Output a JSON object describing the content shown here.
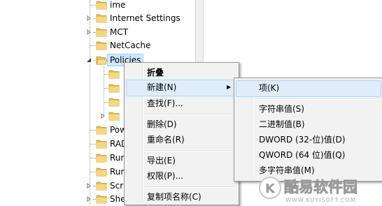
{
  "tree": {
    "items": [
      {
        "label": "ime",
        "expander": "none"
      },
      {
        "label": "Internet Settings",
        "expander": "collapsed"
      },
      {
        "label": "MCT",
        "expander": "collapsed"
      },
      {
        "label": "NetCache",
        "expander": "none"
      },
      {
        "label": "Policies",
        "expander": "expanded",
        "selected": true
      },
      {
        "label": "",
        "expander": "none"
      },
      {
        "label": "",
        "expander": "none"
      },
      {
        "label": "",
        "expander": "none"
      },
      {
        "label": "",
        "expander": "collapsed"
      },
      {
        "label": "Pow",
        "expander": "none"
      },
      {
        "label": "RAD",
        "expander": "none"
      },
      {
        "label": "Run",
        "expander": "none"
      },
      {
        "label": "Run",
        "expander": "none"
      },
      {
        "label": "Scr",
        "expander": "collapsed"
      },
      {
        "label": "She",
        "expander": "collapsed"
      }
    ]
  },
  "context_menu": {
    "items": [
      {
        "label": "折叠",
        "bold": true
      },
      {
        "label": "新建(N)",
        "submenu": true,
        "highlighted": true
      },
      {
        "label": "查找(F)..."
      },
      {
        "separator": true
      },
      {
        "label": "删除(D)"
      },
      {
        "label": "重命名(R)"
      },
      {
        "separator": true
      },
      {
        "label": "导出(E)"
      },
      {
        "label": "权限(P)..."
      },
      {
        "separator": true
      },
      {
        "label": "复制项名称(C)"
      }
    ]
  },
  "submenu": {
    "items": [
      {
        "label": "项(K)",
        "highlighted": true
      },
      {
        "separator": true
      },
      {
        "label": "字符串值(S)"
      },
      {
        "label": "二进制值(B)"
      },
      {
        "label": "DWORD (32-位)值(D)"
      },
      {
        "label": "QWORD (64 位)值(Q)"
      },
      {
        "label": "多字符串值(M)"
      }
    ]
  },
  "watermark": {
    "logo_letter": "K",
    "title": "酷易软件园",
    "url": "WWW.KUYISOFT.COM"
  },
  "colors": {
    "selection_bg": "#cde8ff",
    "menu_bg": "#f2f2f2",
    "menu_highlight": "#e0ecf9",
    "folder": "#e8c25a"
  }
}
